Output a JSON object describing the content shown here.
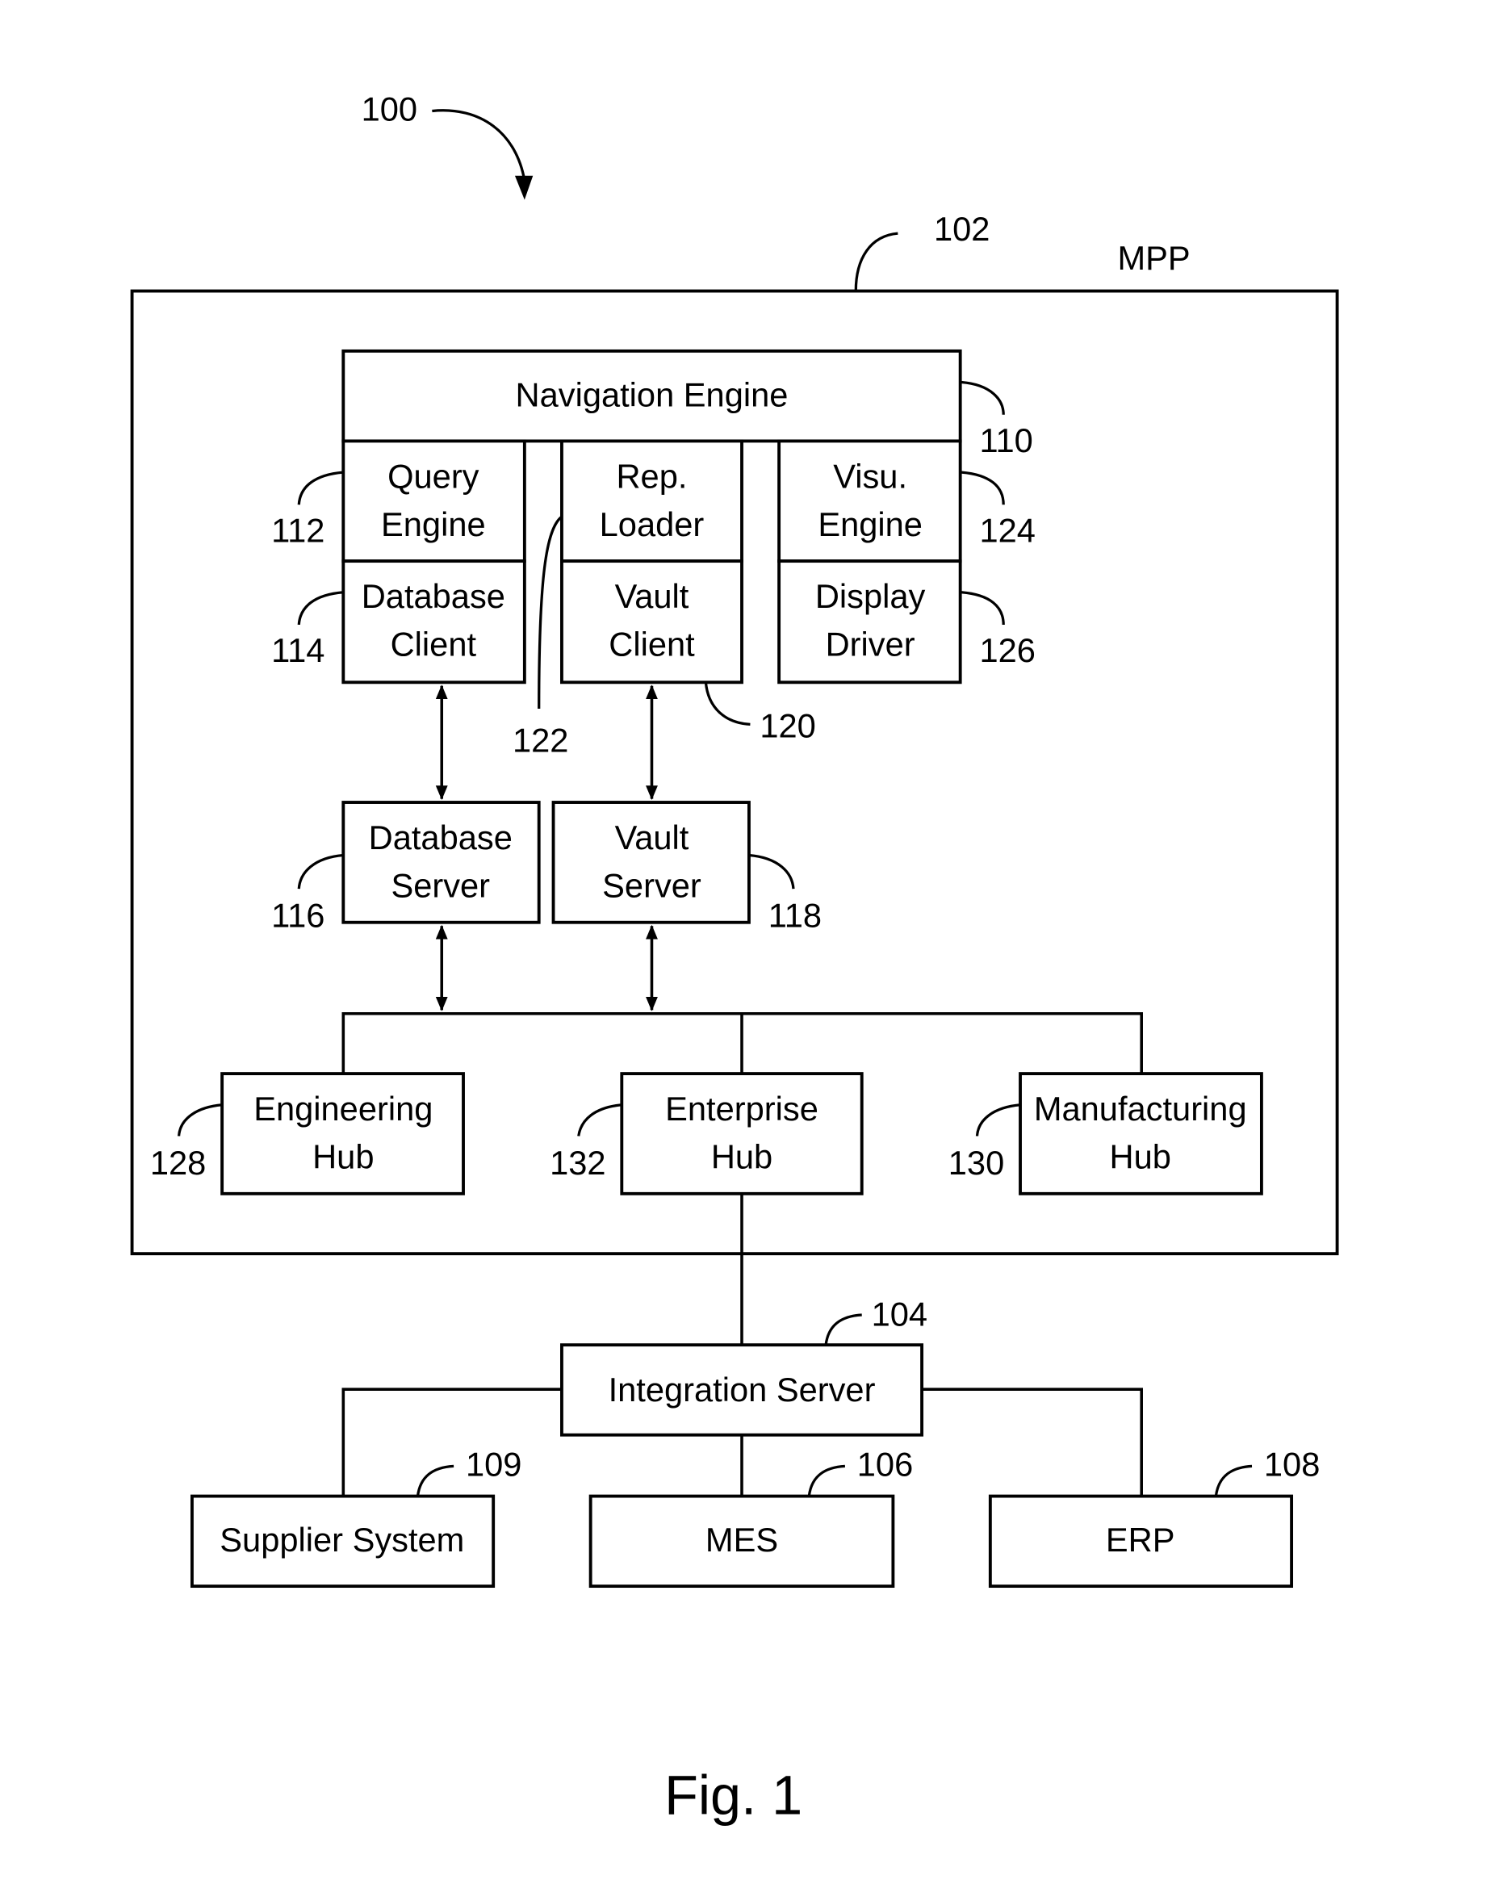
{
  "figure": {
    "caption": "Fig. 1",
    "system_ref": "100",
    "platform_ref": "102",
    "platform_label": "MPP"
  },
  "components": {
    "navigation_engine": {
      "label": "Navigation Engine",
      "ref": "110"
    },
    "query_engine": {
      "line1": "Query",
      "line2": "Engine",
      "ref": "112"
    },
    "database_client": {
      "line1": "Database",
      "line2": "Client",
      "ref": "114"
    },
    "rep_loader": {
      "line1": "Rep.",
      "line2": "Loader",
      "ref": "122"
    },
    "vault_client": {
      "line1": "Vault",
      "line2": "Client",
      "ref": "120"
    },
    "visu_engine": {
      "line1": "Visu.",
      "line2": "Engine",
      "ref": "124"
    },
    "display_driver": {
      "line1": "Display",
      "line2": "Driver",
      "ref": "126"
    },
    "database_server": {
      "line1": "Database",
      "line2": "Server",
      "ref": "116"
    },
    "vault_server": {
      "line1": "Vault",
      "line2": "Server",
      "ref": "118"
    },
    "engineering_hub": {
      "line1": "Engineering",
      "line2": "Hub",
      "ref": "128"
    },
    "enterprise_hub": {
      "line1": "Enterprise",
      "line2": "Hub",
      "ref": "132"
    },
    "manufacturing_hub": {
      "line1": "Manufacturing",
      "line2": "Hub",
      "ref": "130"
    },
    "integration_server": {
      "label": "Integration Server",
      "ref": "104"
    },
    "supplier_system": {
      "label": "Supplier System",
      "ref": "109"
    },
    "mes": {
      "label": "MES",
      "ref": "106"
    },
    "erp": {
      "label": "ERP",
      "ref": "108"
    }
  }
}
